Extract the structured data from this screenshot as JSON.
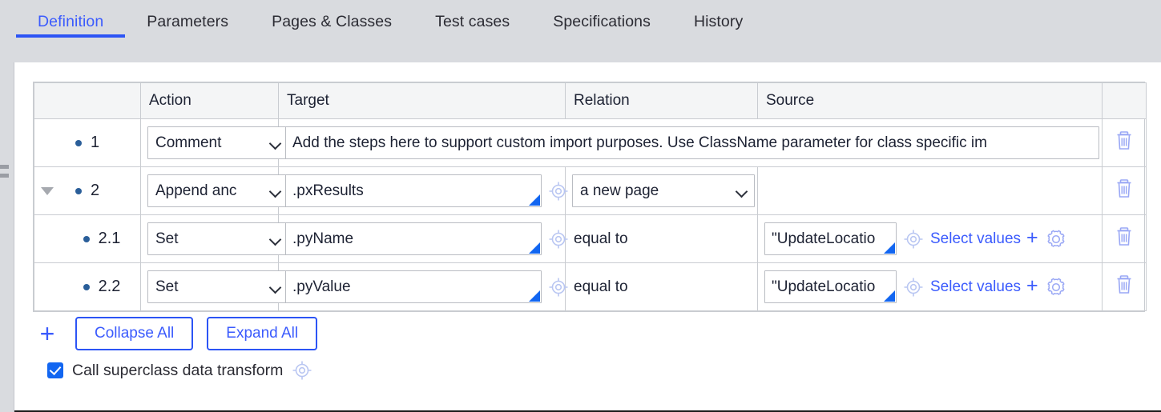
{
  "tabs": [
    {
      "label": "Definition",
      "active": true
    },
    {
      "label": "Parameters",
      "active": false
    },
    {
      "label": "Pages & Classes",
      "active": false
    },
    {
      "label": "Test cases",
      "active": false
    },
    {
      "label": "Specifications",
      "active": false
    },
    {
      "label": "History",
      "active": false
    }
  ],
  "colors": {
    "accent": "#3b5bfd",
    "accent_strong": "#2c54f5",
    "header_band": "#d9dbdf",
    "grid_border": "#c9ccd1",
    "bullet": "#2a5e99",
    "resize_corner": "#1266f1",
    "trash": "#9aa8f5"
  },
  "table": {
    "headers": {
      "num": "",
      "action": "Action",
      "target": "Target",
      "relation": "Relation",
      "source": "Source",
      "delete": ""
    },
    "rows": [
      {
        "number": "1",
        "has_caret": false,
        "indent": false,
        "action": "Comment",
        "target": "Add the steps here to support custom import purposes. Use ClassName parameter for class specific im",
        "target_kind": "wide-comment",
        "relation": "",
        "relation_kind": "none",
        "source": "",
        "source_kind": "none",
        "delete_icon": "trash-icon"
      },
      {
        "number": "2",
        "has_caret": true,
        "indent": false,
        "action": "Append and Map to",
        "action_display": "Append anc",
        "target": ".pxResults",
        "target_kind": "field",
        "relation": "a new page",
        "relation_kind": "select",
        "source": "",
        "source_kind": "none",
        "delete_icon": "trash-icon"
      },
      {
        "number": "2.1",
        "has_caret": false,
        "indent": true,
        "action": "Set",
        "action_display": "Set",
        "target": ".pyName",
        "target_kind": "field",
        "relation": "equal to",
        "relation_kind": "text",
        "source": "\"UpdateLocatio",
        "source_kind": "field",
        "select_values_label": "Select values",
        "delete_icon": "trash-icon"
      },
      {
        "number": "2.2",
        "has_caret": false,
        "indent": true,
        "action": "Set",
        "action_display": "Set",
        "target": ".pyValue",
        "target_kind": "field",
        "relation": "equal to",
        "relation_kind": "text",
        "source": "\"UpdateLocatio",
        "source_kind": "field",
        "select_values_label": "Select values",
        "delete_icon": "trash-icon"
      }
    ]
  },
  "toolbar": {
    "add_label": "+",
    "collapse_all": "Collapse All",
    "expand_all": "Expand All"
  },
  "footer": {
    "checkbox_label": "Call superclass data transform",
    "checkbox_checked": true
  }
}
